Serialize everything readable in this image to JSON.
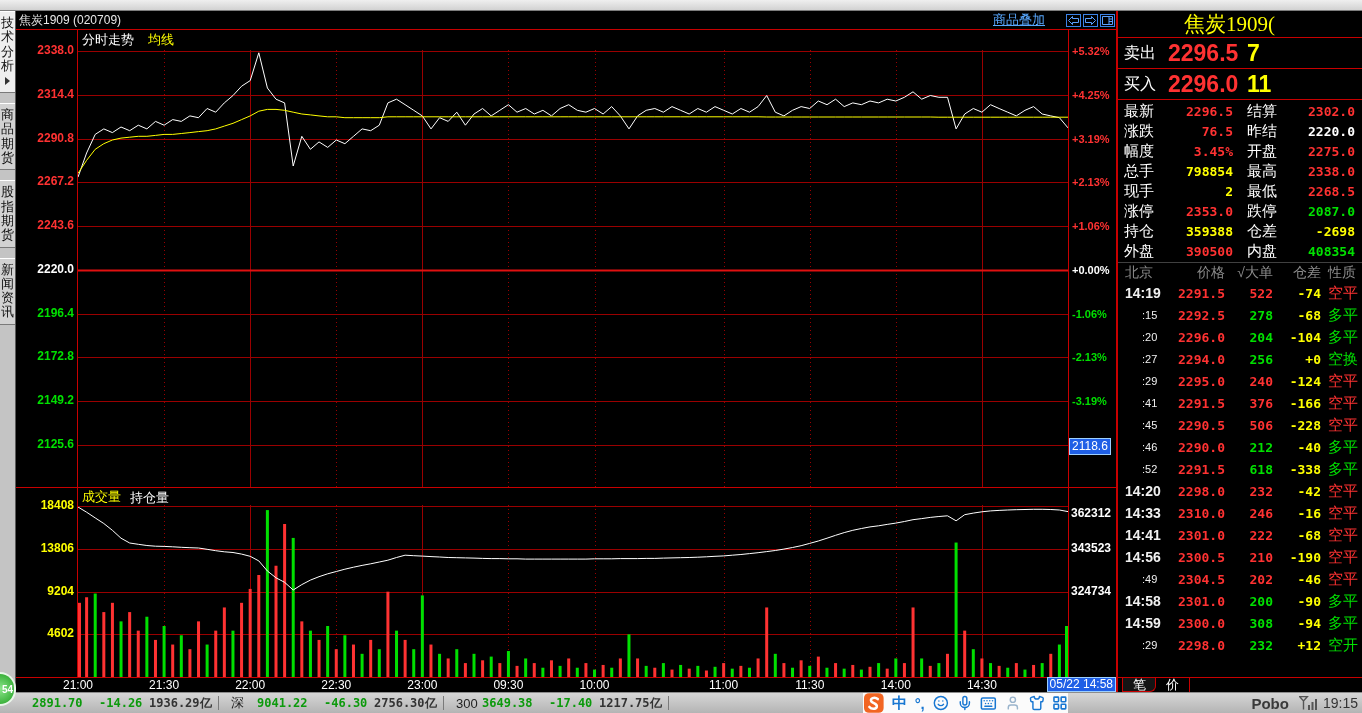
{
  "sidebar": {
    "tabs": [
      {
        "label": "技术分析",
        "selected": true
      },
      {
        "label": "商品期货",
        "selected": false
      },
      {
        "label": "股指期货",
        "selected": false
      },
      {
        "label": "新闻资讯",
        "selected": false
      }
    ]
  },
  "chart_header": {
    "title": "焦炭1909 (020709)",
    "link": "商品叠加"
  },
  "price_chart": {
    "chart_data": {
      "type": "line",
      "title": "分时走势",
      "grid": true,
      "categories": [
        null,
        null,
        null,
        null,
        null,
        null,
        null,
        null,
        null,
        null,
        null,
        null,
        null,
        null,
        null,
        null,
        null,
        null,
        null,
        null,
        null,
        null,
        null,
        null,
        null,
        null,
        null,
        null,
        null,
        null,
        null,
        null,
        null,
        null,
        null,
        null,
        null,
        null,
        null,
        null,
        null,
        null,
        null,
        null,
        null,
        null,
        null,
        null,
        null,
        null,
        null,
        null,
        null,
        null,
        null,
        null,
        null,
        null,
        null,
        null,
        null,
        null,
        null,
        null,
        null,
        null,
        null,
        null,
        null,
        null,
        null,
        null,
        null,
        null,
        null,
        null,
        null,
        null,
        null,
        null,
        null,
        null,
        null,
        null,
        null,
        null,
        null,
        null,
        null,
        null,
        null,
        null,
        null,
        null,
        null,
        null,
        null,
        null,
        null,
        null,
        null,
        null,
        null,
        null,
        null,
        null,
        null,
        null,
        null,
        null,
        null,
        null,
        null,
        null,
        null,
        null
      ],
      "series": [
        {
          "color": "#ffffff",
          "values": [
            2270,
            2283,
            2293,
            2296,
            2294,
            2297,
            2295,
            2298,
            2296,
            2300,
            2298,
            2301,
            2300,
            2303,
            2302,
            2307,
            2305,
            2310,
            2314,
            2319,
            2322,
            2337,
            2318,
            2312,
            2310,
            2276,
            2292,
            2285,
            2289,
            2286,
            2290,
            2288,
            2292,
            2296,
            2295,
            2298,
            2310,
            2312,
            2309,
            2306,
            2303,
            2296,
            2302,
            2300,
            2305,
            2298,
            2304,
            2307,
            2303,
            2306,
            2309,
            2305,
            2307,
            2304,
            2306,
            2303,
            2307,
            2309,
            2306,
            2305,
            2307,
            2304,
            2308,
            2303,
            2296,
            2303,
            2306,
            2307,
            2305,
            2308,
            2306,
            2304,
            2307,
            2305,
            2308,
            2306,
            2304,
            2307,
            2305,
            2308,
            2314,
            2305,
            2303,
            2306,
            2308,
            2307,
            2311,
            2309,
            2312,
            2308,
            2310,
            2309,
            2311,
            2310,
            2312,
            2311,
            2313,
            2316,
            2312,
            2314,
            2313,
            2313,
            2296,
            2304,
            2307,
            2305,
            2309,
            2307,
            2305,
            2303,
            2306,
            2308,
            2304,
            2303,
            2302,
            2296.5
          ]
        },
        {
          "name": "均线",
          "color": "#ffff00",
          "values": [
            2272,
            2279,
            2285,
            2288,
            2290,
            2291,
            2291.5,
            2292,
            2292,
            2292.5,
            2293,
            2293,
            2293.5,
            2294,
            2294.5,
            2295,
            2296,
            2297.5,
            2299,
            2301,
            2303,
            2305.5,
            2306.5,
            2306.5,
            2306,
            2305,
            2304,
            2303.5,
            2303,
            2302.5,
            2302.5,
            2302,
            2302,
            2302,
            2302,
            2302,
            2302.5,
            2302.5,
            2302.5,
            2302.5,
            2302.5,
            2302.5,
            2302.5,
            2302.5,
            2302.5,
            2302.5,
            2302.5,
            2302.5,
            2302.5,
            2302.5,
            2302.5,
            2302.5,
            2302.5,
            2302.5,
            2302.5,
            2302.5,
            2302.5,
            2302.5,
            2302.5,
            2302.5,
            2302.5,
            2302.5,
            2302.5,
            2302.5,
            2302.5,
            2302.5,
            2302.5,
            2302.5,
            2302.5,
            2302.5,
            2302.5,
            2302.5,
            2302.5,
            2302.5,
            2302.5,
            2302.5,
            2302.5,
            2302.5,
            2302.5,
            2302.5,
            2302.4,
            2302.4,
            2302.4,
            2302.4,
            2302.4,
            2302.4,
            2302.4,
            2302.4,
            2302.4,
            2302.4,
            2302.4,
            2302.4,
            2302.4,
            2302.4,
            2302.4,
            2302.4,
            2302.4,
            2302.4,
            2302.4,
            2302.4,
            2302.3,
            2302.3,
            2302.3,
            2302.3,
            2302.3,
            2302.3,
            2302.3,
            2302.3,
            2302.3,
            2302.3,
            2302.3,
            2302.3,
            2302.3,
            2302.3,
            2302.3,
            2302.3
          ]
        }
      ],
      "ylim": [
        2103.0,
        2338.5
      ],
      "yticks": [
        {
          "value": 2338,
          "label": "2338.0"
        },
        {
          "value": 2314.4,
          "label": "2314.4"
        },
        {
          "value": 2290.8,
          "label": "2290.8"
        },
        {
          "value": 2267.2,
          "label": "2267.2"
        },
        {
          "value": 2243.6,
          "label": "2243.6"
        },
        {
          "value": 2220,
          "label": "2220.0"
        },
        {
          "value": 2196.4,
          "label": "2196.4"
        },
        {
          "value": 2172.8,
          "label": "2172.8"
        },
        {
          "value": 2149.2,
          "label": "2149.2"
        },
        {
          "value": 2125.6,
          "label": "2125.6"
        }
      ],
      "ref_lines": [
        {
          "axis": "y",
          "value": 2220
        }
      ]
    },
    "right_axis_labels": [
      "+5.32%",
      "+4.25%",
      "+3.19%",
      "+2.13%",
      "+1.06%",
      "+0.00%",
      "-1.06%",
      "-2.13%",
      "-3.19%"
    ]
  },
  "volume_chart": {
    "chart_data": {
      "type": "bar",
      "title": "成交量",
      "grid": true,
      "stacked": true,
      "categories": [
        "21:00",
        null,
        null,
        null,
        null,
        null,
        null,
        null,
        null,
        null,
        "21:30",
        null,
        null,
        null,
        null,
        null,
        null,
        null,
        null,
        null,
        "22:00",
        null,
        null,
        null,
        null,
        null,
        null,
        null,
        null,
        null,
        "22:30",
        null,
        null,
        null,
        null,
        null,
        null,
        null,
        null,
        null,
        "23:00",
        null,
        null,
        null,
        null,
        null,
        null,
        null,
        null,
        null,
        "09:30",
        null,
        null,
        null,
        null,
        null,
        null,
        null,
        null,
        null,
        "10:00",
        null,
        null,
        null,
        null,
        null,
        null,
        null,
        null,
        null,
        null,
        null,
        null,
        null,
        null,
        "11:00",
        null,
        null,
        null,
        null,
        null,
        null,
        null,
        null,
        null,
        "11:30",
        null,
        null,
        null,
        null,
        null,
        null,
        null,
        null,
        null,
        "14:00",
        null,
        null,
        null,
        null,
        null,
        null,
        null,
        null,
        null,
        "14:30",
        null,
        null,
        null,
        null,
        null,
        null,
        null,
        null,
        null,
        null
      ],
      "series": [
        {
          "color": "#ff3232",
          "values": [
            8000,
            8600,
            null,
            7000,
            8000,
            null,
            7000,
            5000,
            null,
            4000,
            null,
            3500,
            null,
            3000,
            6000,
            null,
            5000,
            7500,
            null,
            8000,
            9500,
            11000,
            null,
            12000,
            16500,
            null,
            6000,
            null,
            4000,
            null,
            3000,
            null,
            3500,
            null,
            4000,
            null,
            9200,
            null,
            4000,
            null,
            null,
            3500,
            null,
            2000,
            null,
            1500,
            null,
            1800,
            null,
            1500,
            null,
            1200,
            null,
            1500,
            null,
            1800,
            null,
            2000,
            null,
            1500,
            null,
            1300,
            null,
            2000,
            null,
            2000,
            null,
            1000,
            null,
            800,
            null,
            900,
            null,
            700,
            null,
            1500,
            null,
            1200,
            null,
            2000,
            7500,
            null,
            1500,
            null,
            1800,
            null,
            2200,
            null,
            1500,
            null,
            1300,
            null,
            1100,
            null,
            900,
            null,
            1500,
            7500,
            null,
            1200,
            null,
            2500,
            null,
            5000,
            null,
            2000,
            null,
            1200,
            null,
            1500,
            null,
            1300,
            null,
            2500,
            null,
            null
          ]
        },
        {
          "color": "#00e000",
          "values": [
            null,
            null,
            9000,
            null,
            null,
            6000,
            null,
            null,
            6500,
            null,
            5500,
            null,
            4500,
            null,
            null,
            3500,
            null,
            null,
            5000,
            null,
            null,
            null,
            18000,
            null,
            null,
            15000,
            null,
            5000,
            null,
            5500,
            null,
            4500,
            null,
            2500,
            null,
            3000,
            null,
            5000,
            null,
            3000,
            8800,
            null,
            2500,
            null,
            3000,
            null,
            2500,
            null,
            2200,
            null,
            2800,
            null,
            2000,
            null,
            1000,
            null,
            1200,
            null,
            1000,
            null,
            800,
            null,
            1000,
            null,
            4600,
            null,
            1200,
            null,
            1500,
            null,
            1300,
            null,
            1200,
            null,
            1100,
            null,
            900,
            null,
            1000,
            null,
            null,
            2500,
            null,
            1000,
            null,
            1200,
            null,
            1000,
            null,
            900,
            null,
            800,
            null,
            1500,
            null,
            2000,
            null,
            null,
            2000,
            null,
            1500,
            null,
            14500,
            null,
            3000,
            null,
            1500,
            null,
            1000,
            null,
            800,
            null,
            1500,
            null,
            3500,
            5500
          ]
        }
      ],
      "ylim": [
        0,
        18550
      ],
      "yticks": [
        18408,
        13806,
        9204,
        4602
      ]
    }
  },
  "open_interest_chart": {
    "chart_data": {
      "type": "line",
      "title": "持仓量",
      "categories": [
        null,
        null,
        null,
        null,
        null,
        null,
        null,
        null,
        null,
        null,
        null,
        null,
        null,
        null,
        null,
        null,
        null,
        null,
        null,
        null,
        null,
        null,
        null,
        null,
        null,
        null,
        null,
        null,
        null,
        null,
        null,
        null,
        null,
        null,
        null,
        null,
        null,
        null,
        null,
        null,
        null,
        null,
        null,
        null,
        null,
        null,
        null,
        null,
        null,
        null,
        null,
        null,
        null,
        null,
        null,
        null,
        null,
        null,
        null,
        null,
        null,
        null,
        null,
        null,
        null,
        null,
        null,
        null,
        null,
        null,
        null,
        null,
        null,
        null,
        null,
        null,
        null,
        null,
        null,
        null,
        null,
        null,
        null,
        null,
        null,
        null,
        null,
        null,
        null,
        null,
        null,
        null,
        null,
        null,
        null,
        null,
        null,
        null,
        null,
        null,
        null,
        null,
        null,
        null,
        null,
        null,
        null,
        null,
        null,
        null,
        null,
        null,
        null,
        null,
        null,
        null
      ],
      "series": [
        {
          "color": "#ffffff",
          "values": [
            362300,
            360000,
            357500,
            355000,
            352000,
            348500,
            346400,
            345800,
            345300,
            345000,
            344900,
            344700,
            344500,
            344300,
            344200,
            343600,
            343000,
            342500,
            342200,
            341500,
            340500,
            338500,
            334000,
            331000,
            329000,
            325600,
            328000,
            330000,
            331500,
            332800,
            333800,
            334800,
            335700,
            336500,
            337200,
            338000,
            338800,
            340000,
            341000,
            340800,
            340600,
            340400,
            340200,
            340000,
            339900,
            339800,
            339700,
            339600,
            339500,
            339500,
            339400,
            339400,
            339300,
            339300,
            339300,
            339300,
            339300,
            339300,
            339300,
            339300,
            339400,
            339400,
            339400,
            339500,
            339500,
            339500,
            339600,
            339600,
            339700,
            339800,
            339900,
            340000,
            340100,
            340300,
            340500,
            340700,
            341000,
            341300,
            341700,
            342100,
            342600,
            343100,
            343700,
            344400,
            345200,
            346200,
            347300,
            348500,
            349800,
            351000,
            352000,
            352800,
            353500,
            354000,
            354600,
            355200,
            355900,
            356700,
            357200,
            357700,
            358100,
            358400,
            356200,
            358900,
            359600,
            360200,
            360600,
            360800,
            361000,
            361100,
            361200,
            361300,
            361300,
            361200,
            361000,
            360300
          ]
        }
      ],
      "ylim": [
        287155,
        362312
      ],
      "yticks": [
        362312,
        343523,
        324734
      ]
    }
  },
  "cursor": {
    "price": "2118.6",
    "time": "05/22 14:58"
  },
  "floating_badge": "54",
  "quote": {
    "title": "焦炭1909(",
    "ask": {
      "label": "卖出",
      "price": "2296.5",
      "size": "7"
    },
    "bid": {
      "label": "买入",
      "price": "2296.0",
      "size": "11"
    },
    "stats": [
      {
        "label": "最新",
        "value": "2296.5",
        "color": "#ff3232"
      },
      {
        "label": "结算",
        "value": "2302.0",
        "color": "#ff3232"
      },
      {
        "label": "涨跌",
        "value": "76.5",
        "color": "#ff3232"
      },
      {
        "label": "昨结",
        "value": "2220.0",
        "color": "#ffffff"
      },
      {
        "label": "幅度",
        "value": "3.45%",
        "color": "#ff3232"
      },
      {
        "label": "开盘",
        "value": "2275.0",
        "color": "#ff3232"
      },
      {
        "label": "总手",
        "value": "798854",
        "color": "#ffff00"
      },
      {
        "label": "最高",
        "value": "2338.0",
        "color": "#ff3232"
      },
      {
        "label": "现手",
        "value": "2",
        "color": "#ffff00"
      },
      {
        "label": "最低",
        "value": "2268.5",
        "color": "#ff3232"
      },
      {
        "label": "涨停",
        "value": "2353.0",
        "color": "#ff3232"
      },
      {
        "label": "跌停",
        "value": "2087.0",
        "color": "#00e000"
      },
      {
        "label": "持仓",
        "value": "359388",
        "color": "#ffff00"
      },
      {
        "label": "仓差",
        "value": "-2698",
        "color": "#ffff00"
      },
      {
        "label": "外盘",
        "value": "390500",
        "color": "#ff3232"
      },
      {
        "label": "内盘",
        "value": "408354",
        "color": "#00e000"
      }
    ]
  },
  "trades": {
    "columns": [
      "北京",
      "价格",
      "√大单",
      "仓差",
      "性质"
    ],
    "rows": [
      {
        "time": "14:19",
        "kind": "minute",
        "price": "2291.5",
        "volume": "522",
        "oi_change": "-74",
        "type": "空平",
        "color": "#ff3232"
      },
      {
        "time": ":15",
        "kind": "second",
        "price": "2292.5",
        "volume": "278",
        "oi_change": "-68",
        "type": "多平",
        "color": "#00e000"
      },
      {
        "time": ":20",
        "kind": "second",
        "price": "2296.0",
        "volume": "204",
        "oi_change": "-104",
        "type": "多平",
        "color": "#00e000"
      },
      {
        "time": ":27",
        "kind": "second",
        "price": "2294.0",
        "volume": "256",
        "oi_change": "+0",
        "type": "空换",
        "color": "#00e000"
      },
      {
        "time": ":29",
        "kind": "second",
        "price": "2295.0",
        "volume": "240",
        "oi_change": "-124",
        "type": "空平",
        "color": "#ff3232"
      },
      {
        "time": ":41",
        "kind": "second",
        "price": "2291.5",
        "volume": "376",
        "oi_change": "-166",
        "type": "空平",
        "color": "#ff3232"
      },
      {
        "time": ":45",
        "kind": "second",
        "price": "2290.5",
        "volume": "506",
        "oi_change": "-228",
        "type": "空平",
        "color": "#ff3232"
      },
      {
        "time": ":46",
        "kind": "second",
        "price": "2290.0",
        "volume": "212",
        "oi_change": "-40",
        "type": "多平",
        "color": "#00e000"
      },
      {
        "time": ":52",
        "kind": "second",
        "price": "2291.5",
        "volume": "618",
        "oi_change": "-338",
        "type": "多平",
        "color": "#00e000"
      },
      {
        "time": "14:20",
        "kind": "minute",
        "price": "2298.0",
        "volume": "232",
        "oi_change": "-42",
        "type": "空平",
        "color": "#ff3232"
      },
      {
        "time": "14:33",
        "kind": "minute",
        "price": "2310.0",
        "volume": "246",
        "oi_change": "-16",
        "type": "空平",
        "color": "#ff3232"
      },
      {
        "time": "14:41",
        "kind": "minute",
        "price": "2301.0",
        "volume": "222",
        "oi_change": "-68",
        "type": "空平",
        "color": "#ff3232"
      },
      {
        "time": "14:56",
        "kind": "minute",
        "price": "2300.5",
        "volume": "210",
        "oi_change": "-190",
        "type": "空平",
        "color": "#ff3232"
      },
      {
        "time": ":49",
        "kind": "second",
        "price": "2304.5",
        "volume": "202",
        "oi_change": "-46",
        "type": "空平",
        "color": "#ff3232"
      },
      {
        "time": "14:58",
        "kind": "minute",
        "price": "2301.0",
        "volume": "200",
        "oi_change": "-90",
        "type": "多平",
        "color": "#00e000"
      },
      {
        "time": "14:59",
        "kind": "minute",
        "price": "2300.0",
        "volume": "308",
        "oi_change": "-94",
        "type": "多平",
        "color": "#00e000"
      },
      {
        "time": ":29",
        "kind": "second",
        "price": "2298.0",
        "volume": "232",
        "oi_change": "+12",
        "type": "空开",
        "color": "#00e000"
      }
    ]
  },
  "bottom_tabs": [
    {
      "label": "笔",
      "selected": true
    },
    {
      "label": "价",
      "selected": false
    }
  ],
  "status_bar": {
    "indices": [
      {
        "value": "2891.70",
        "change": "-14.26",
        "turnover": "1936.29亿"
      },
      {
        "name": "深",
        "value": "9041.22",
        "change": "-46.30",
        "turnover": "2756.30亿"
      },
      {
        "name": "300",
        "value": "3649.38",
        "change": "-17.40",
        "turnover": "1217.75亿"
      }
    ],
    "ime": {
      "mode": "中",
      "punctuation": "°,"
    },
    "brand": "Pobo",
    "clock": "19:15"
  }
}
